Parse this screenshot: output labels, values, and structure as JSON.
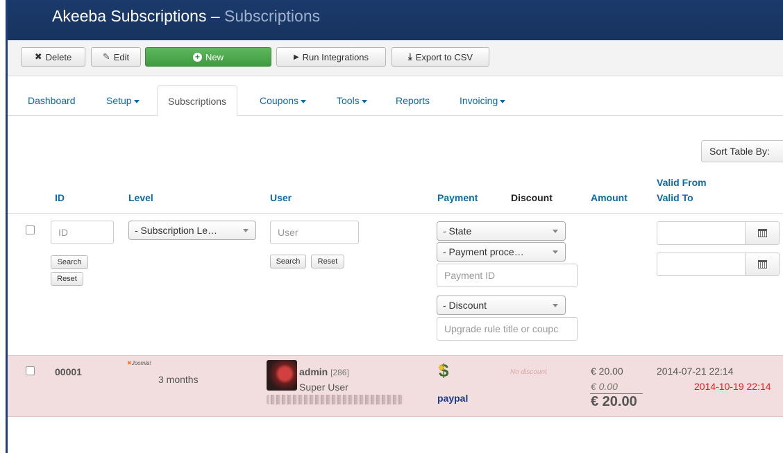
{
  "header": {
    "app": "Akeeba Subscriptions",
    "separator": "–",
    "section": "Subscriptions"
  },
  "toolbar": {
    "delete": "Delete",
    "edit": "Edit",
    "new": "New",
    "run_integrations": "Run Integrations",
    "export_csv": "Export to CSV"
  },
  "tabs": {
    "dashboard": "Dashboard",
    "setup": "Setup",
    "subscriptions": "Subscriptions",
    "coupons": "Coupons",
    "tools": "Tools",
    "reports": "Reports",
    "invoicing": "Invoicing"
  },
  "sort": {
    "label": "Sort Table By:"
  },
  "columns": {
    "id": "ID",
    "level": "Level",
    "user": "User",
    "payment": "Payment",
    "discount": "Discount",
    "amount": "Amount",
    "valid_from": "Valid From",
    "valid_to": "Valid To"
  },
  "filters": {
    "id_placeholder": "ID",
    "level_select": "- Subscription Le…",
    "user_placeholder": "User",
    "search": "Search",
    "reset": "Reset",
    "state_select": "- State",
    "processor_select": "- Payment proce…",
    "payment_id_placeholder": "Payment ID",
    "discount_select": "- Discount",
    "upgrade_placeholder": "Upgrade rule title or coupc"
  },
  "rows": [
    {
      "id": "00001",
      "level_brand": "Joomla!",
      "level": "3 months",
      "username": "admin",
      "user_id": "[286]",
      "user_name": "Super User",
      "payment_method": "paypal",
      "discount": "No discount",
      "net": "€ 20.00",
      "tax": "€ 0.00",
      "gross": "€ 20.00",
      "valid_from": "2014-07-21 22:14",
      "valid_to": "2014-10-19 22:14"
    }
  ]
}
